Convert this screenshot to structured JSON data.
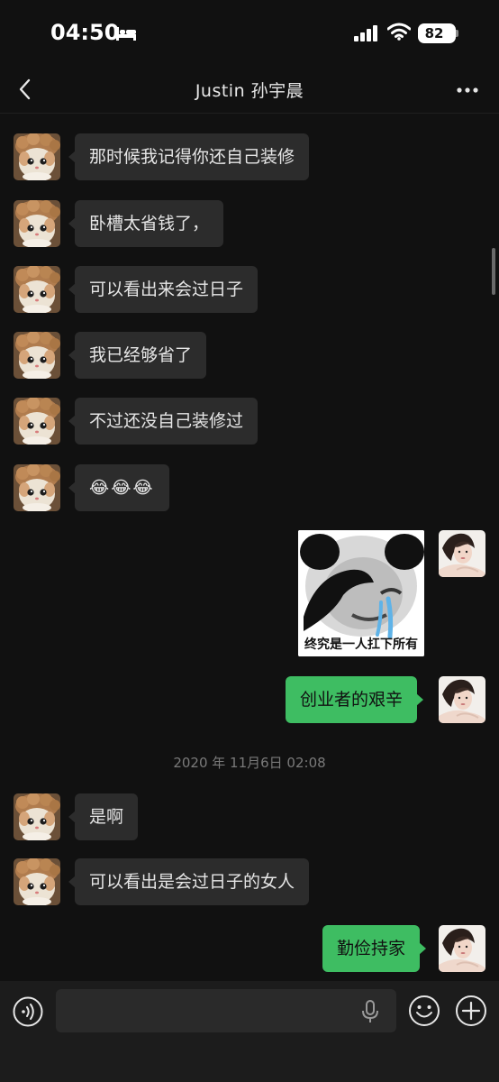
{
  "status_bar": {
    "time": "04:50",
    "battery": "82"
  },
  "header": {
    "title": "Justin 孙宇晨"
  },
  "messages": [
    {
      "text": "那时候我记得你还自己装修"
    },
    {
      "text": "卧槽太省钱了，"
    },
    {
      "text": "可以看出来会过日子"
    },
    {
      "text": "我已经够省了"
    },
    {
      "text": "不过还没自己装修过"
    },
    {
      "text": "😂😂😂"
    },
    {
      "sticker_caption": "终究是一人扛下所有"
    },
    {
      "text": "创业者的艰辛"
    },
    {
      "text": "是啊"
    },
    {
      "text": "可以看出是会过日子的女人"
    },
    {
      "text": "勤俭持家"
    }
  ],
  "timestamp": "2020 年 11月6日 02:08",
  "colors": {
    "background": "#111111",
    "incoming_bubble": "#2c2c2c",
    "outgoing_bubble": "#3ebd62"
  },
  "icons": [
    "bed-icon",
    "signal-icon",
    "wifi-icon",
    "back-icon",
    "more-icon",
    "voice-icon",
    "mic-icon",
    "emoji-icon",
    "plus-icon"
  ]
}
